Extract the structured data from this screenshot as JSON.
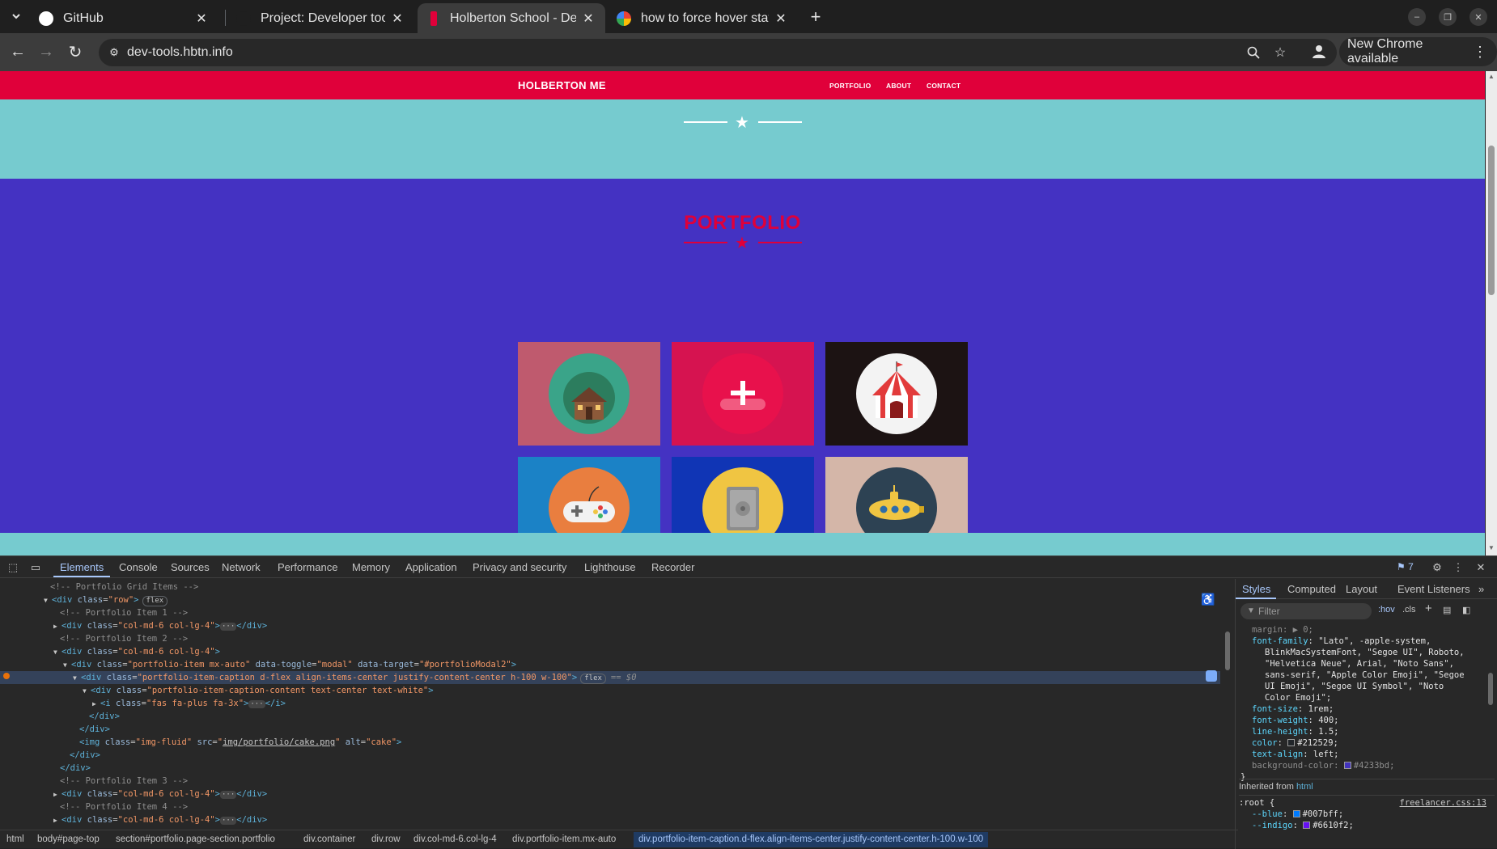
{
  "browser": {
    "tabs": [
      {
        "title": "GitHub",
        "favicon": "github-icon",
        "color": "#ffffff"
      },
      {
        "title": "Project: Developer tools",
        "favicon": "holberton-icon",
        "color": "#1f1f1f"
      },
      {
        "title": "Holberton School - Devel",
        "favicon": "holberton-icon",
        "color": "#e0003a"
      },
      {
        "title": "how to force hover state",
        "favicon": "google-icon",
        "color": "#4285f4"
      }
    ],
    "url": "dev-tools.hbtn.info",
    "new_chrome_label": "New Chrome available"
  },
  "site": {
    "brand": "HOLBERTON ME",
    "nav_links": [
      "PORTFOLIO",
      "ABOUT",
      "CONTACT"
    ],
    "portfolio_title": "PORTFOLIO",
    "tiles": [
      {
        "icon": "cabin-icon",
        "bg": "#bf5a6e",
        "circle": "#3aa489"
      },
      {
        "icon": "cake-plus-icon",
        "bg": "#d61350",
        "circle": "#e8114c"
      },
      {
        "icon": "circus-tent-icon",
        "bg": "#1c1313",
        "circle": "#f3f3f3"
      },
      {
        "icon": "game-controller-icon",
        "bg": "#1b82c6",
        "circle": "#e97e3f"
      },
      {
        "icon": "safe-icon",
        "bg": "#1035b5",
        "circle": "#f0c542"
      },
      {
        "icon": "submarine-icon",
        "bg": "#d4b6a8",
        "circle": "#2d4253"
      }
    ]
  },
  "devtools": {
    "tabs": [
      "Elements",
      "Console",
      "Sources",
      "Network",
      "Performance",
      "Memory",
      "Application",
      "Privacy and security",
      "Lighthouse",
      "Recorder"
    ],
    "issues_count": "7",
    "dom_lines": [
      {
        "text": "<!-- Portfolio Grid Items -->"
      },
      {
        "text": "<div class=\"row\">",
        "badge": "flex"
      },
      {
        "text": "<!-- Portfolio Item 1 -->"
      },
      {
        "text": "<div class=\"col-md-6 col-lg-4\"> ··· </div>"
      },
      {
        "text": "<!-- Portfolio Item 2 -->"
      },
      {
        "text": "<div class=\"col-md-6 col-lg-4\">"
      },
      {
        "text": "<div class=\"portfolio-item mx-auto\" data-toggle=\"modal\" data-target=\"#portfolioModal2\">"
      },
      {
        "text": "<div class=\"portfolio-item-caption d-flex align-items-center justify-content-center h-100 w-100\">",
        "badge": "flex",
        "suffix": "== $0"
      },
      {
        "text": "<div class=\"portfolio-item-caption-content text-center text-white\">"
      },
      {
        "text": "<i class=\"fas fa-plus fa-3x\"> ··· </i>"
      },
      {
        "text": "</div>"
      },
      {
        "text": "</div>"
      },
      {
        "text": "<img class=\"img-fluid\" src=\"img/portfolio/cake.png\" alt=\"cake\">"
      },
      {
        "text": "</div>"
      },
      {
        "text": "</div>"
      },
      {
        "text": "<!-- Portfolio Item 3 -->"
      },
      {
        "text": "<div class=\"col-md-6 col-lg-4\"> ··· </div>"
      },
      {
        "text": "<!-- Portfolio Item 4 -->"
      },
      {
        "text": "<div class=\"col-md-6 col-lg-4\"> ··· </div>"
      }
    ],
    "breadcrumbs": [
      "html",
      "body#page-top",
      "section#portfolio.page-section.portfolio",
      "div.container",
      "div.row",
      "div.col-md-6.col-lg-4",
      "div.portfolio-item.mx-auto",
      "div.portfolio-item-caption.d-flex.align-items-center.justify-content-center.h-100.w-100"
    ],
    "styles_tabs": [
      "Styles",
      "Computed",
      "Layout",
      "Event Listeners"
    ],
    "filter_placeholder": "Filter",
    "hov_label": ":hov",
    "cls_label": ".cls",
    "css_lines": [
      {
        "name": "margin",
        "value": "▶ 0;",
        "dim": true
      },
      {
        "name": "font-family",
        "value": "\"Lato\", -apple-system,"
      },
      {
        "name": "",
        "value": "BlinkMacSystemFont, \"Segoe UI\", Roboto,"
      },
      {
        "name": "",
        "value": "\"Helvetica Neue\", Arial, \"Noto Sans\","
      },
      {
        "name": "",
        "value": "sans-serif, \"Apple Color Emoji\", \"Segoe"
      },
      {
        "name": "",
        "value": "UI Emoji\", \"Segoe UI Symbol\", \"Noto"
      },
      {
        "name": "",
        "value": "Color Emoji\";"
      },
      {
        "name": "font-size",
        "value": "1rem;"
      },
      {
        "name": "font-weight",
        "value": "400;"
      },
      {
        "name": "line-height",
        "value": "1.5;"
      },
      {
        "name": "color",
        "value": "#212529;",
        "swatch": "#212529"
      },
      {
        "name": "text-align",
        "value": "left;"
      },
      {
        "name": "background-color",
        "value": "#4233bd;",
        "swatch": "#4233bd",
        "dim": true
      },
      {
        "name": "}",
        "value": ""
      }
    ],
    "inherited_label": "Inherited from",
    "inherited_tag": "html",
    "root_selector": ":root {",
    "root_source": "freelancer.css:13",
    "root_lines": [
      {
        "name": "--blue",
        "value": "#007bff;",
        "swatch": "#007bff"
      },
      {
        "name": "--indigo",
        "value": "#6610f2;",
        "swatch": "#6610f2"
      }
    ]
  }
}
